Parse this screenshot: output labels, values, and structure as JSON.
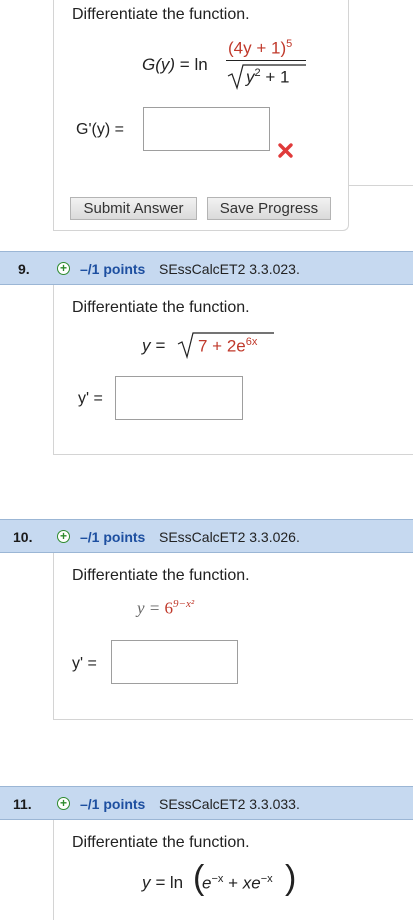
{
  "q8": {
    "prompt": "Differentiate the function.",
    "lhs": "G(y)",
    "eq": "=",
    "fn": "ln",
    "numerator": "(4y + 1)",
    "numerator_exp": "5",
    "denominator": "y",
    "denominator_exp": "2",
    "denominator_tail": " + 1",
    "answer_label": "G'(y) =",
    "answer_value": "",
    "submit_label": "Submit Answer",
    "save_label": "Save Progress"
  },
  "q9": {
    "number": "9.",
    "points": "–/1 points",
    "source": "SEssCalcET2 3.3.023.",
    "prompt": "Differentiate the function.",
    "lhs": "y =",
    "radicand_red": "7 + 2e",
    "radicand_exp": "6x",
    "answer_label": "y' =",
    "answer_value": ""
  },
  "q10": {
    "number": "10.",
    "points": "–/1 points",
    "source": "SEssCalcET2 3.3.026.",
    "prompt": "Differentiate the function.",
    "lhs": "y =",
    "base": "6",
    "exponent": "9−x²",
    "answer_label": "y' =",
    "answer_value": ""
  },
  "q11": {
    "number": "11.",
    "points": "–/1 points",
    "source": "SEssCalcET2 3.3.033.",
    "prompt": "Differentiate the function.",
    "lhs": "y =",
    "fn": "ln",
    "term1": "e",
    "term1_exp": "−x",
    "plus": " + ",
    "term2": "xe",
    "term2_exp": "−x"
  },
  "colors": {
    "header_bg": "#c6d9f0",
    "points_blue": "#1d4fa0",
    "math_red": "#c0392b",
    "error_red": "#e03a3a",
    "plus_green": "#2e8b2e"
  }
}
